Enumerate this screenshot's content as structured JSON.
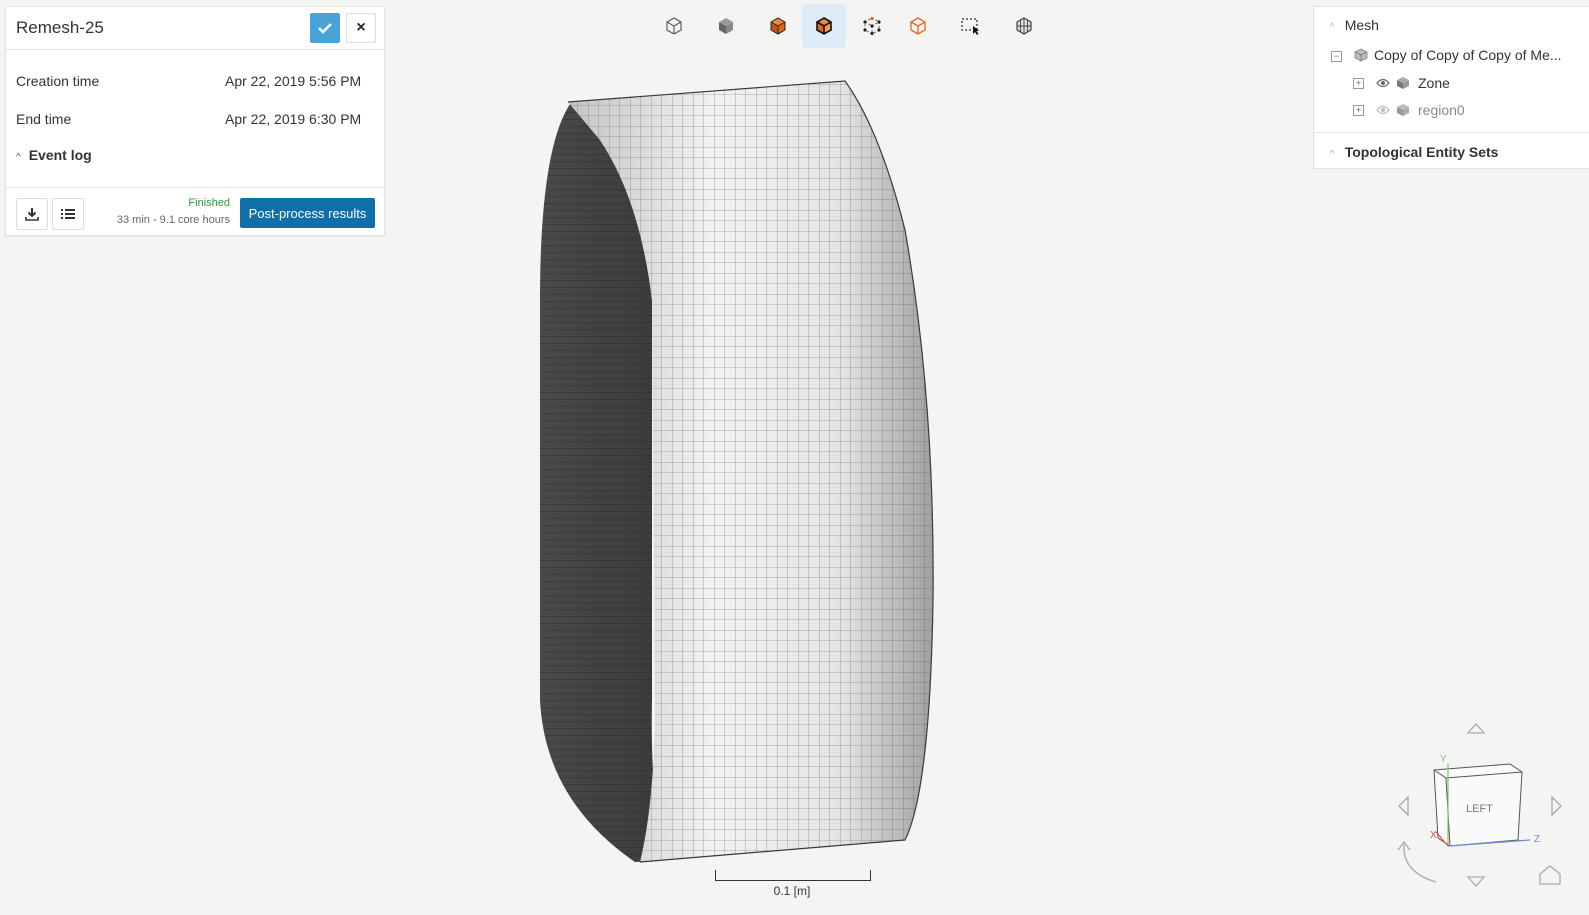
{
  "job": {
    "title": "Remesh-25",
    "creation_label": "Creation time",
    "creation_value": "Apr 22, 2019 5:56 PM",
    "end_label": "End time",
    "end_value": "Apr 22, 2019 6:30 PM",
    "event_log_label": "Event log",
    "status": "Finished",
    "status_detail": "33 min - 9.1 core hours",
    "postprocess_label": "Post-process results"
  },
  "toolbar": {
    "icons": [
      "wireframe-cube-icon",
      "solid-cube-icon",
      "orange-solid-cube-icon",
      "orange-edges-cube-icon",
      "vertices-cube-icon",
      "orange-outline-cube-icon",
      "box-select-icon",
      "mesh-settings-icon"
    ],
    "active_index": 3,
    "accent": "#e0661a"
  },
  "tree": {
    "section_mesh": "Mesh",
    "root_label": "Copy of Copy of Copy of Me...",
    "children": [
      {
        "label": "Zone"
      },
      {
        "label": "region0"
      }
    ],
    "section_topo": "Topological Entity Sets"
  },
  "viewport": {
    "scale_label": "0.1 [m]",
    "view_cube_face": "LEFT",
    "axes": [
      "Y",
      "X",
      "Z"
    ]
  },
  "colors": {
    "primary": "#0f6fa8",
    "confirm": "#4aa3d8",
    "success": "#2a9a3a"
  }
}
